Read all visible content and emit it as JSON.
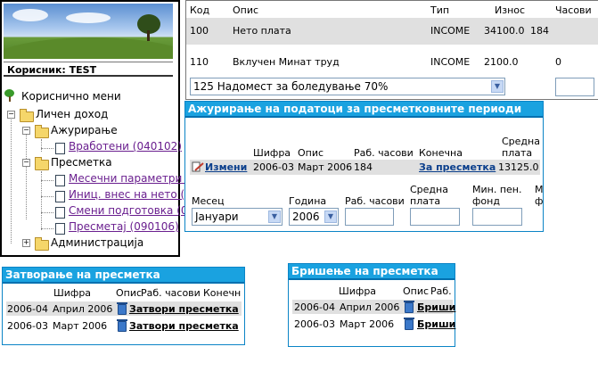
{
  "left_panel": {
    "user_label": "Корисник: TEST",
    "menu_title": "Кориснично мени",
    "tree": [
      {
        "label": "Личен доход",
        "link": false
      },
      {
        "label": "Ажурирање",
        "link": false
      },
      {
        "label": "Вработени (040102)",
        "link": true
      },
      {
        "label": "Пресметка",
        "link": false
      },
      {
        "label": "Месечни параметри (",
        "link": true
      },
      {
        "label": "Иниц. внес на нето (",
        "link": true
      },
      {
        "label": "Смени подготовка (0",
        "link": true
      },
      {
        "label": "Пресметај (090106)",
        "link": true
      },
      {
        "label": "Администрација",
        "link": false
      }
    ]
  },
  "top_table": {
    "headers": [
      "Код",
      "Опис",
      "Тип",
      "Износ",
      "Часови"
    ],
    "rows": [
      [
        "100",
        "Нето плата",
        "INCOME",
        "34100.0",
        "184"
      ],
      [
        "110",
        "Вклучен Минат труд",
        "INCOME",
        "2100.0",
        "0"
      ]
    ],
    "select_value": "125 Надомест за боледување 70%"
  },
  "update_panel": {
    "title": "Ажурирање на податоци за пресметковните периоди",
    "headers": {
      "code": "Шифра",
      "desc": "Опис",
      "hours": "Раб. часови",
      "final": "Конечна",
      "avg1": "Средна",
      "avg2": "плата"
    },
    "row": {
      "edit": "Измени",
      "code": "2006-03",
      "desc": "Март 2006",
      "hours": "184",
      "calc": "За пресметка",
      "avg": "13125.0"
    },
    "form": {
      "month_label": "Месец",
      "month_value": "Јануари",
      "year_label": "Година",
      "year_value": "2006",
      "hours_label": "Раб. часови",
      "avg1": "Средна",
      "avg2": "плата",
      "minfund1": "Мин. пен.",
      "minfund2": "фонд",
      "extra1": "М",
      "extra2": "ф"
    }
  },
  "close_panel": {
    "title": "Затворање на пресметка",
    "headers": {
      "code": "Шифра",
      "desc": "Опис",
      "hours": "Раб. часови",
      "final": "Конечн"
    },
    "rows": [
      {
        "code": "2006-04",
        "desc": "Април 2006",
        "action": "Затвори пресметка"
      },
      {
        "code": "2006-03",
        "desc": "Март 2006",
        "action": "Затвори пресметка"
      }
    ]
  },
  "delete_panel": {
    "title": "Бришење на пресметка",
    "headers": {
      "code": "Шифра",
      "desc": "Опис",
      "hours": "Раб."
    },
    "rows": [
      {
        "code": "2006-04",
        "desc": "Април 2006",
        "action": "Бриши"
      },
      {
        "code": "2006-03",
        "desc": "Март 2006",
        "action": "Бриши"
      }
    ]
  }
}
